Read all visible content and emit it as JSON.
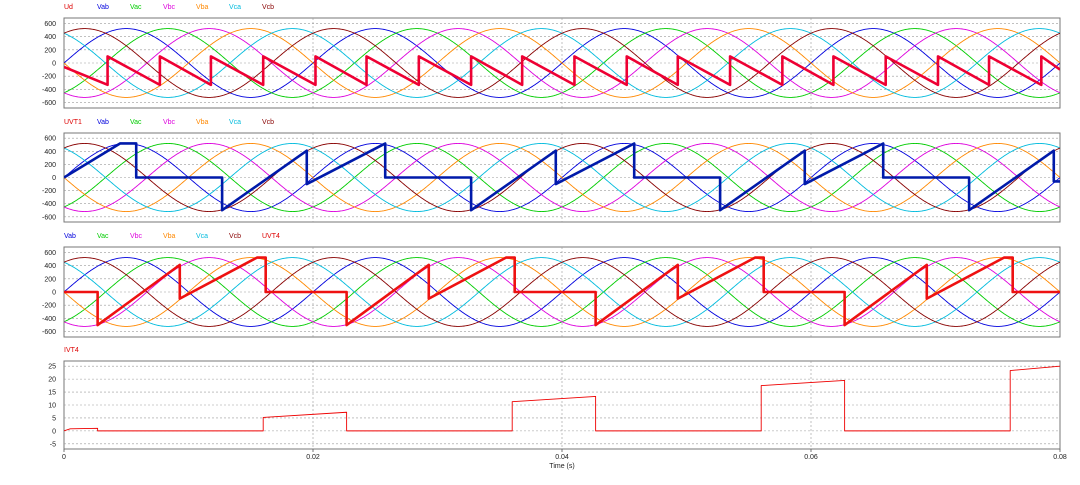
{
  "chart_data": [
    {
      "type": "line",
      "legend": [
        "Ud",
        "Vab",
        "Vac",
        "Vbc",
        "Vba",
        "Vca",
        "Vcb"
      ],
      "legend_colors": [
        "#dd0000",
        "#0000dd",
        "#00cc00",
        "#dd00dd",
        "#ff8800",
        "#00bbdd",
        "#880000"
      ],
      "xlim": [
        0,
        0.08
      ],
      "ylim": [
        -680,
        680
      ],
      "yticks": [
        "600",
        "400",
        "200",
        "0",
        "-200",
        "-400",
        "-600"
      ],
      "ytick_values": [
        600,
        400,
        200,
        0,
        -200,
        -400,
        -600
      ],
      "series_amplitude": 520,
      "series_frequency_hz": 50,
      "series": [
        {
          "name": "Vab",
          "color": "#0000dd",
          "phase_deg": 0
        },
        {
          "name": "Vac",
          "color": "#00cc00",
          "phase_deg": -60
        },
        {
          "name": "Vbc",
          "color": "#dd00dd",
          "phase_deg": -120
        },
        {
          "name": "Vba",
          "color": "#ff8800",
          "phase_deg": 180
        },
        {
          "name": "Vca",
          "color": "#00bbdd",
          "phase_deg": 120
        },
        {
          "name": "Vcb",
          "color": "#880000",
          "phase_deg": 60
        },
        {
          "name": "Ud",
          "color": "#ee0033",
          "bold": true,
          "kind": "rectified_sawtooth",
          "x": [
            0,
            0.0035,
            0.0035,
            0.0077,
            0.0077,
            0.0118,
            0.0118,
            0.016,
            0.016,
            0.0202,
            0.0202,
            0.0243,
            0.0243,
            0.0285,
            0.0285,
            0.0327,
            0.0327,
            0.0368,
            0.0368,
            0.041,
            0.041,
            0.0452,
            0.0452,
            0.0493,
            0.0493,
            0.0535,
            0.0535,
            0.0577,
            0.0577,
            0.0618,
            0.0618,
            0.066,
            0.066,
            0.0702,
            0.0702,
            0.0743,
            0.0743,
            0.0785,
            0.0785,
            0.08
          ],
          "y": [
            -60,
            -330,
            100,
            -330,
            100,
            -330,
            100,
            -330,
            100,
            -330,
            100,
            -330,
            100,
            -330,
            100,
            -330,
            100,
            -330,
            100,
            -330,
            100,
            -330,
            100,
            -330,
            100,
            -330,
            100,
            -330,
            100,
            -330,
            100,
            -330,
            100,
            -330,
            100,
            -330,
            100,
            -330,
            100,
            -100
          ]
        }
      ]
    },
    {
      "type": "line",
      "legend": [
        "UVT1",
        "Vab",
        "Vac",
        "Vbc",
        "Vba",
        "Vca",
        "Vcb"
      ],
      "legend_colors": [
        "#dd0000",
        "#0000dd",
        "#00cc00",
        "#dd00dd",
        "#ff8800",
        "#00bbdd",
        "#880000"
      ],
      "xlim": [
        0,
        0.08
      ],
      "ylim": [
        -680,
        680
      ],
      "yticks": [
        "600",
        "400",
        "200",
        "0",
        "-200",
        "-400",
        "-600"
      ],
      "ytick_values": [
        600,
        400,
        200,
        0,
        -200,
        -400,
        -600
      ],
      "series_amplitude": 520,
      "series_frequency_hz": 50,
      "series": [
        {
          "name": "Vab",
          "color": "#0000dd",
          "phase_deg": 0
        },
        {
          "name": "Vac",
          "color": "#00cc00",
          "phase_deg": -60
        },
        {
          "name": "Vbc",
          "color": "#dd00dd",
          "phase_deg": -120
        },
        {
          "name": "Vba",
          "color": "#ff8800",
          "phase_deg": 180
        },
        {
          "name": "Vca",
          "color": "#00bbdd",
          "phase_deg": 120
        },
        {
          "name": "Vcb",
          "color": "#880000",
          "phase_deg": 60
        },
        {
          "name": "UVT1",
          "color": "#001aaa",
          "bold": true,
          "x": [
            0,
            0.0045,
            0.0058,
            0.0058,
            0.0127,
            0.0127,
            0.0195,
            0.0195,
            0.0258,
            0.0258,
            0.0327,
            0.0327,
            0.0395,
            0.0395,
            0.0458,
            0.0458,
            0.0527,
            0.0527,
            0.0595,
            0.0595,
            0.0658,
            0.0658,
            0.0727,
            0.0727,
            0.0795,
            0.0795,
            0.08
          ],
          "y": [
            0,
            520,
            520,
            0,
            0,
            -500,
            410,
            -100,
            520,
            0,
            0,
            -500,
            410,
            -100,
            520,
            0,
            0,
            -500,
            410,
            -100,
            520,
            0,
            0,
            -500,
            410,
            -60,
            -60
          ]
        }
      ]
    },
    {
      "type": "line",
      "legend": [
        "Vab",
        "Vac",
        "Vbc",
        "Vba",
        "Vca",
        "Vcb",
        "UVT4"
      ],
      "legend_colors": [
        "#0000dd",
        "#00cc00",
        "#dd00dd",
        "#ff8800",
        "#00bbdd",
        "#880000",
        "#dd0000"
      ],
      "xlim": [
        0,
        0.08
      ],
      "ylim": [
        -680,
        680
      ],
      "yticks": [
        "600",
        "400",
        "200",
        "0",
        "-200",
        "-400",
        "-600"
      ],
      "ytick_values": [
        600,
        400,
        200,
        0,
        -200,
        -400,
        -600
      ],
      "series_amplitude": 520,
      "series_frequency_hz": 50,
      "series": [
        {
          "name": "Vab",
          "color": "#0000dd",
          "phase_deg": 0
        },
        {
          "name": "Vac",
          "color": "#00cc00",
          "phase_deg": -60
        },
        {
          "name": "Vbc",
          "color": "#dd00dd",
          "phase_deg": -120
        },
        {
          "name": "Vba",
          "color": "#ff8800",
          "phase_deg": 180
        },
        {
          "name": "Vca",
          "color": "#00bbdd",
          "phase_deg": 120
        },
        {
          "name": "Vcb",
          "color": "#880000",
          "phase_deg": 60
        },
        {
          "name": "UVT4",
          "color": "#ee1111",
          "bold": true,
          "x": [
            0,
            0.0027,
            0.0027,
            0.0093,
            0.0093,
            0.0155,
            0.0162,
            0.0162,
            0.0227,
            0.0227,
            0.0293,
            0.0293,
            0.0355,
            0.0362,
            0.0362,
            0.0427,
            0.0427,
            0.0493,
            0.0493,
            0.0555,
            0.0562,
            0.0562,
            0.0627,
            0.0627,
            0.0693,
            0.0693,
            0.0755,
            0.0762,
            0.0762,
            0.08
          ],
          "y": [
            0,
            0,
            -500,
            410,
            -100,
            520,
            520,
            0,
            0,
            -500,
            410,
            -100,
            520,
            520,
            0,
            0,
            -500,
            410,
            -100,
            520,
            520,
            0,
            0,
            -500,
            410,
            -100,
            520,
            520,
            0,
            0
          ]
        }
      ]
    },
    {
      "type": "line",
      "legend": [
        "IVT4"
      ],
      "legend_colors": [
        "#dd0000"
      ],
      "xlim": [
        0,
        0.08
      ],
      "ylim": [
        -7,
        27
      ],
      "yticks": [
        "25",
        "20",
        "15",
        "10",
        "5",
        "0",
        "-5"
      ],
      "ytick_values": [
        25,
        20,
        15,
        10,
        5,
        0,
        -5
      ],
      "xticks": [
        "0",
        "0.02",
        "0.04",
        "0.06",
        "0.08"
      ],
      "xtick_values": [
        0,
        0.02,
        0.04,
        0.06,
        0.08
      ],
      "xlabel": "Time (s)",
      "series": [
        {
          "name": "IVT4",
          "color": "#ee0000",
          "x": [
            0,
            0.0005,
            0.0027,
            0.0027,
            0.016,
            0.016,
            0.0227,
            0.0227,
            0.036,
            0.036,
            0.0427,
            0.0427,
            0.056,
            0.056,
            0.0627,
            0.0627,
            0.076,
            0.076,
            0.08
          ],
          "y": [
            0,
            0.8,
            1.0,
            0,
            0,
            5.2,
            7.2,
            0,
            0,
            11.3,
            13.3,
            0,
            0,
            17.5,
            19.5,
            0,
            0,
            23.3,
            25
          ]
        }
      ]
    }
  ]
}
